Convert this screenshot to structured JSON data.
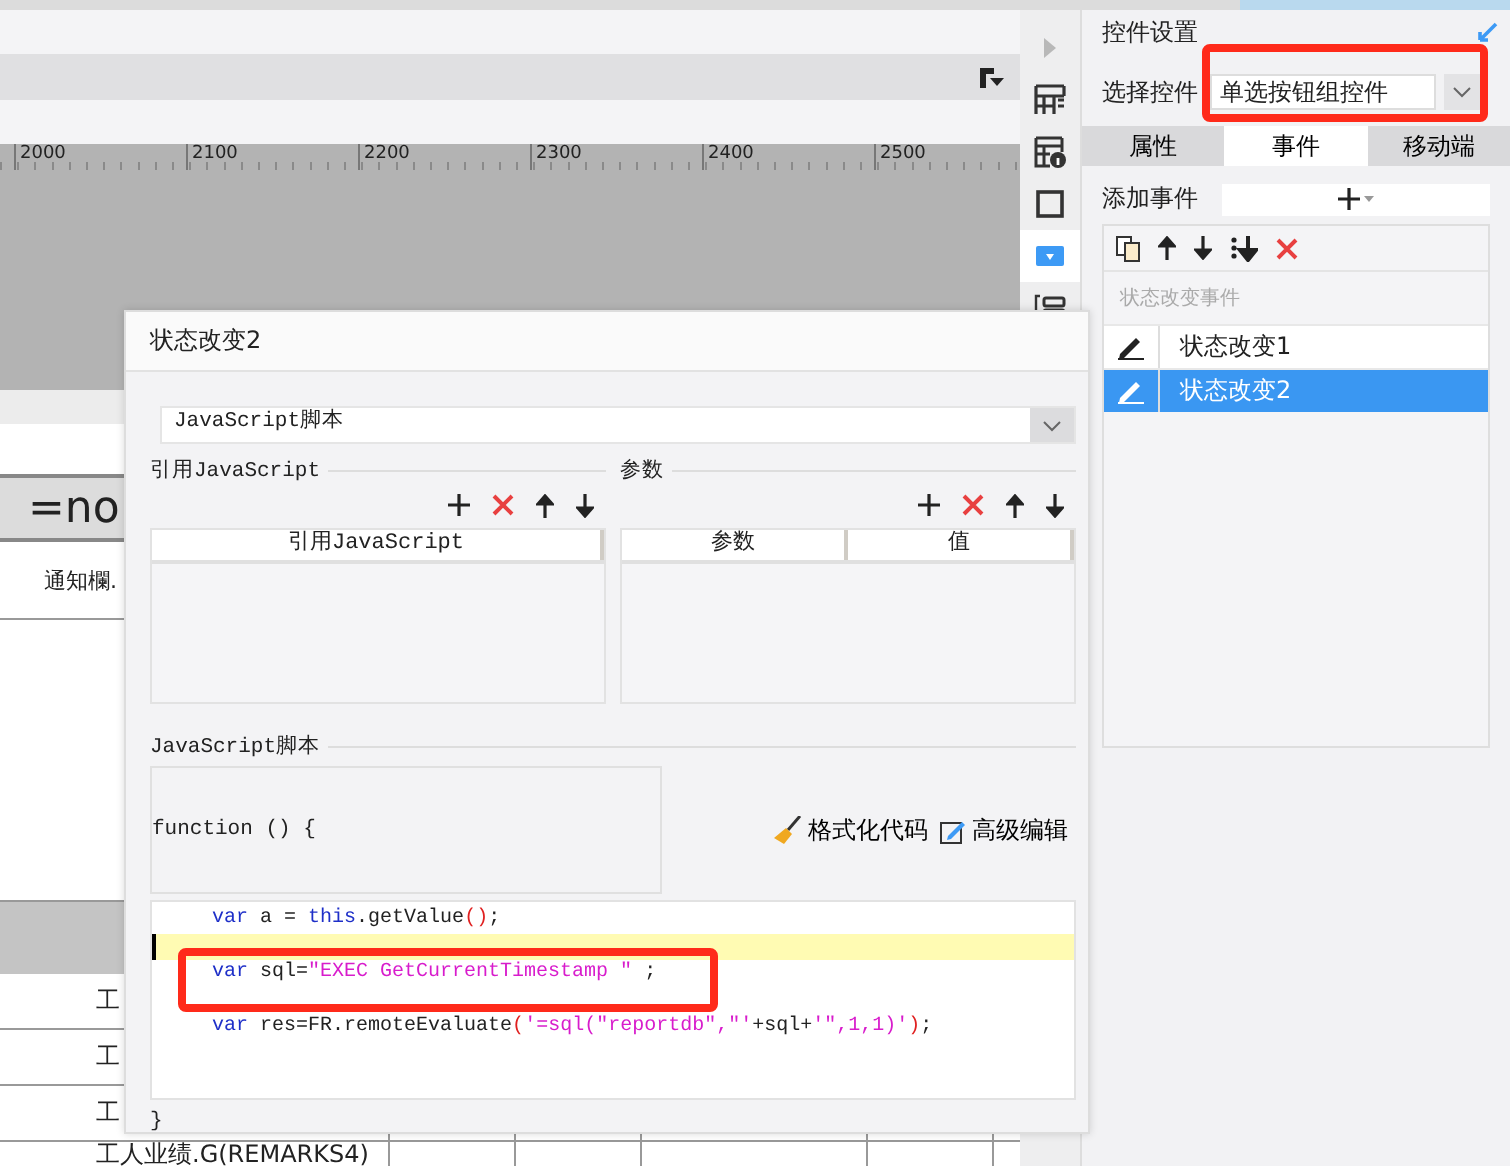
{
  "ruler": {
    "labels": [
      "2000",
      "2100",
      "2200",
      "2300",
      "2400",
      "2500"
    ]
  },
  "sheet": {
    "rows": [
      {
        "kind": "blank"
      },
      {
        "kind": "title",
        "text": "=no"
      },
      {
        "kind": "note",
        "text": "通知欄."
      },
      {
        "kind": "space"
      },
      {
        "kind": "header"
      },
      {
        "kind": "cell",
        "text": "工"
      },
      {
        "kind": "cell",
        "text": "工"
      },
      {
        "kind": "cell",
        "text": "工"
      },
      {
        "kind": "tail",
        "text": "工人业绩.G(REMARKS4)"
      }
    ]
  },
  "side_toolbar": {
    "tools": [
      {
        "kind": "expand",
        "selected": false
      },
      {
        "kind": "column-layout",
        "selected": false
      },
      {
        "kind": "table-info",
        "selected": false
      },
      {
        "kind": "frame",
        "selected": false
      },
      {
        "kind": "dropdown",
        "selected": true
      },
      {
        "kind": "form",
        "selected": false
      }
    ]
  },
  "panel": {
    "title": "控件设置",
    "select_label": "选择控件",
    "select_value": "单选按钮组控件",
    "select_highlighted": true,
    "tabs": [
      {
        "label": "属性",
        "selected": false
      },
      {
        "label": "事件",
        "selected": true
      },
      {
        "label": "移动端",
        "selected": false
      }
    ],
    "add_label": "添加事件",
    "event_group": "状态改变事件",
    "events": [
      {
        "label": "状态改变1",
        "selected": false
      },
      {
        "label": "状态改变2",
        "selected": true
      }
    ]
  },
  "dialog": {
    "title": "状态改变2",
    "type_value": "JavaScript脚本",
    "imports": {
      "legend": "引用JavaScript",
      "columns": [
        "引用JavaScript"
      ]
    },
    "params": {
      "legend": "参数",
      "columns": [
        "参数",
        "值"
      ]
    },
    "script_legend": "JavaScript脚本",
    "signature": "function () {",
    "format_label": "格式化代码",
    "advanced_label": "高级编辑",
    "lines": [
      {
        "current": false,
        "highlighted": false,
        "tokens": [
          {
            "kind": "keyword",
            "text": "var"
          },
          {
            "kind": "plain",
            "text": " a = "
          },
          {
            "kind": "keyword",
            "text": "this"
          },
          {
            "kind": "plain",
            "text": ".getValue"
          },
          {
            "kind": "paren",
            "text": "()"
          },
          {
            "kind": "plain",
            "text": ";"
          }
        ]
      },
      {
        "current": true,
        "highlighted": false
      },
      {
        "current": false,
        "highlighted": true,
        "tokens": [
          {
            "kind": "keyword",
            "text": "var"
          },
          {
            "kind": "plain",
            "text": " sql="
          },
          {
            "kind": "string",
            "text": "\"EXEC GetCurrentTimestamp \""
          },
          {
            "kind": "plain",
            "text": " ;"
          }
        ]
      },
      {
        "current": false,
        "highlighted": false
      },
      {
        "current": false,
        "highlighted": false,
        "tokens": [
          {
            "kind": "keyword",
            "text": "var"
          },
          {
            "kind": "plain",
            "text": " res=FR.remoteEvaluate"
          },
          {
            "kind": "paren",
            "text": "("
          },
          {
            "kind": "string",
            "text": "'=sql(\"reportdb\",\"'"
          },
          {
            "kind": "plain",
            "text": "+sql+"
          },
          {
            "kind": "string",
            "text": "'\",1,1)'"
          },
          {
            "kind": "paren",
            "text": ")"
          },
          {
            "kind": "plain",
            "text": ";"
          }
        ]
      }
    ],
    "closing": "}"
  }
}
